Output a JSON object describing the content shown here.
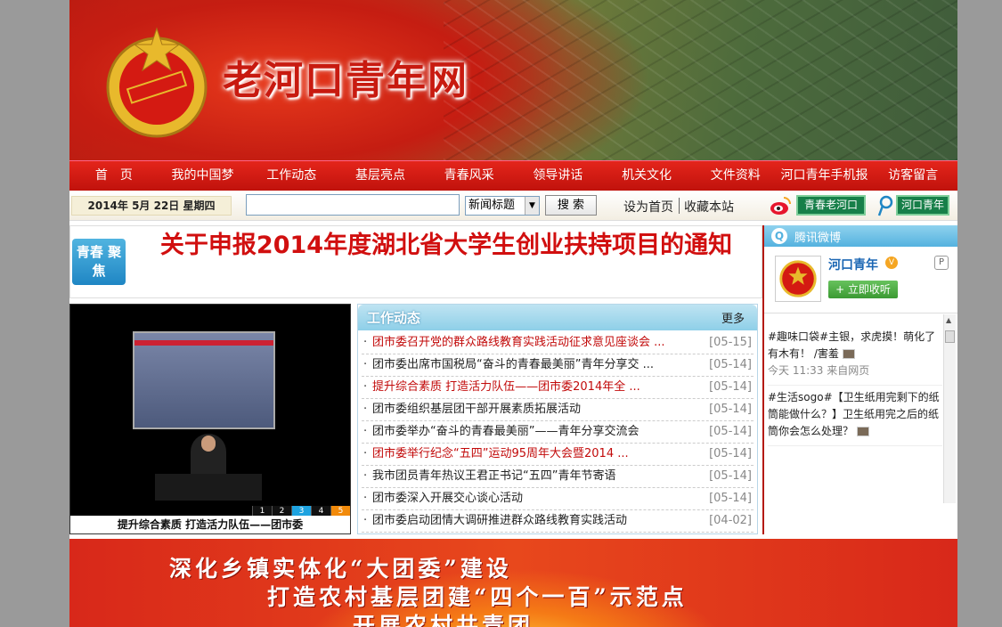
{
  "header": {
    "site_title": "老河口青年网"
  },
  "nav": {
    "items": [
      "首　页",
      "我的中国梦",
      "工作动态",
      "基层亮点",
      "青春风采",
      "领导讲话",
      "机关文化",
      "文件资料",
      "河口青年手机报",
      "访客留言"
    ]
  },
  "toolbar": {
    "date": "2014年 5月 22日 星期四",
    "search_value": "",
    "search_scope": "新闻标题",
    "search_button": "搜 索",
    "set_home": "设为首页",
    "favorite": "收藏本站",
    "weibo_button": "青春老河口",
    "tencent_button": "河口青年"
  },
  "headline": {
    "badge": "青春 聚焦",
    "title": "关于申报2014年度湖北省大学生创业扶持项目的通知"
  },
  "slideshow": {
    "pages": [
      "1",
      "2",
      "3",
      "4",
      "5"
    ],
    "caption": "提升综合素质 打造活力队伍——团市委"
  },
  "news": {
    "title": "工作动态",
    "more": "更多",
    "items": [
      {
        "title": "团市委召开党的群众路线教育实践活动征求意见座谈会 ...",
        "date": "[05-15]",
        "red": true
      },
      {
        "title": "团市委出席市国税局“奋斗的青春最美丽”青年分享交 ...",
        "date": "[05-14]",
        "red": false
      },
      {
        "title": "提升综合素质 打造活力队伍——团市委2014年全 ...",
        "date": "[05-14]",
        "red": true
      },
      {
        "title": "团市委组织基层团干部开展素质拓展活动",
        "date": "[05-14]",
        "red": false
      },
      {
        "title": "团市委举办“奋斗的青春最美丽”——青年分享交流会",
        "date": "[05-14]",
        "red": false
      },
      {
        "title": "团市委举行纪念“五四”运动95周年大会暨2014 ...",
        "date": "[05-14]",
        "red": true
      },
      {
        "title": "我市团员青年热议王君正书记“五四”青年节寄语",
        "date": "[05-14]",
        "red": false
      },
      {
        "title": "团市委深入开展交心谈心活动",
        "date": "[05-14]",
        "red": false
      },
      {
        "title": "团市委启动团情大调研推进群众路线教育实践活动",
        "date": "[04-02]",
        "red": false
      }
    ]
  },
  "sidebar": {
    "title": "腾讯微博",
    "account": "河口青年",
    "follow": "+ 立即收听",
    "posts": [
      {
        "text": "#趣味口袋#主银，求虎摸！萌化了有木有！ /害羞",
        "meta": "今天 11:33 来自网页"
      },
      {
        "text": "#生活sogo#【卫生纸用完剩下的纸筒能做什么？】卫生纸用完之后的纸筒你会怎么处理？",
        "meta": ""
      }
    ]
  },
  "bottom_banner": {
    "lines": [
      "深化乡镇实体化“大团委”建设",
      "打造农村基层团建“四个一百”示范点",
      "开展农村共青团"
    ]
  },
  "colors": {
    "nav_red": "#d41a12",
    "headline_red": "#d10f0f",
    "weibo_green": "#177f49",
    "sky_blue": "#54b2df"
  }
}
